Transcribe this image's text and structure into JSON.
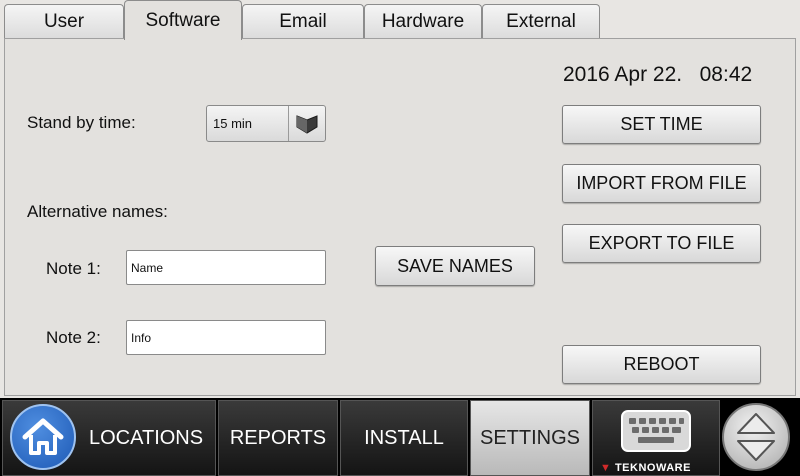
{
  "tabs": [
    {
      "label": "User"
    },
    {
      "label": "Software"
    },
    {
      "label": "Email"
    },
    {
      "label": "Hardware"
    },
    {
      "label": "External"
    }
  ],
  "active_tab": "Software",
  "datetime": {
    "date": "2016 Apr 22.",
    "time": "08:42"
  },
  "standby": {
    "label": "Stand by time:",
    "value": "15 min"
  },
  "alt_names": {
    "label": "Alternative names:",
    "note1": {
      "label": "Note 1:",
      "value": "Name"
    },
    "note2": {
      "label": "Note 2:",
      "value": "Info"
    },
    "save_label": "SAVE NAMES"
  },
  "buttons": {
    "set_time": "SET TIME",
    "import": "IMPORT FROM FILE",
    "export": "EXPORT TO FILE",
    "reboot": "REBOOT"
  },
  "nav": {
    "locations": "LOCATIONS",
    "reports": "REPORTS",
    "install": "INSTALL",
    "settings": "SETTINGS",
    "active": "SETTINGS"
  },
  "icons": {
    "home": "home-icon",
    "keyboard": "keyboard-icon",
    "scroll": "up-down-arrows-icon",
    "dropdown": "chevron-down-icon"
  },
  "colors": {
    "home_button": "#2f6fcc",
    "bottom_bar": "#000000",
    "panel": "#e3e1de"
  },
  "brand": "TEKNOWARE"
}
